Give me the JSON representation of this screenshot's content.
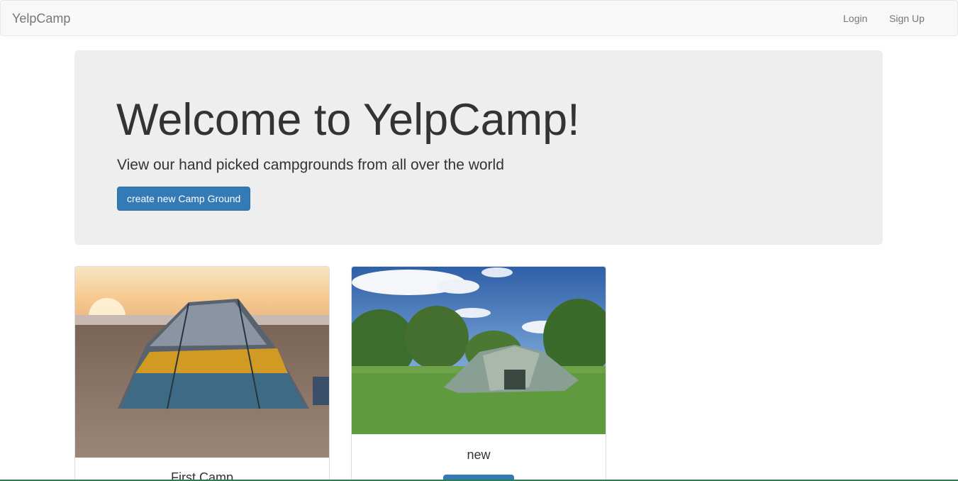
{
  "navbar": {
    "brand": "YelpCamp",
    "login": "Login",
    "signup": "Sign Up"
  },
  "jumbotron": {
    "title": "Welcome to YelpCamp!",
    "subtitle": "View our hand picked campgrounds from all over the world",
    "button": "create new Camp Ground"
  },
  "campgrounds": [
    {
      "name": "First Camp",
      "image": "tent on beach at sunset"
    },
    {
      "name": "new",
      "image": "green tents in grassy campground"
    }
  ],
  "colors": {
    "primary": "#337ab7",
    "navbar_bg": "#f8f8f8",
    "jumbotron_bg": "#eeeeee"
  }
}
